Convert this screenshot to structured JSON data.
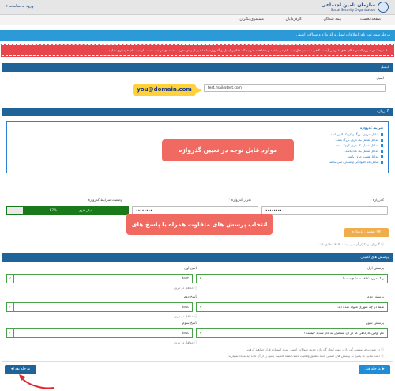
{
  "header": {
    "logo_fa": "سازمان تامین اجتماعی",
    "logo_en": "Social Security Organization",
    "portal_link": "ورود به سامانه"
  },
  "nav": {
    "items": [
      "صفحه نخست",
      "بیمه شدگان",
      "کارفرمایان",
      "مستمری بگیران"
    ]
  },
  "breadcrumb": "مرحله سوم ثبت نام: اطلاعات ایمیل و گذرواژه و سوالات امنیتی",
  "warning": "توجه: در صورتیکه در مکان های عمومی (مانند کافی نت) در حال ثبت نام می باشید و مشاهده نمودید که مقادیر ایمیل و گذرواژه یا مقادیر از پیش تعریف شده ای در ثبت است، از ثبت نام خودداری نمایید.",
  "email": {
    "section": "ایمیل",
    "label": "ایمیل",
    "value": "test.mail@test.com",
    "annotation": "you@domain.com"
  },
  "password": {
    "section": "گذرواژه",
    "rules_title": "شرایط گذرواژه",
    "rules": [
      "شامل حروف بزرگ و کوچک لاتین باشد.",
      "حداقل شامل یک حرف بزرگ باشد.",
      "حداقل شامل یک حرف کوچک باشد.",
      "حداقل شامل یک عدد باشد.",
      "حداقل هشت حرف باشد.",
      "شامل نام خانوادگی و شماره ملی نباشد."
    ],
    "annotation": "موارد قابل توجه در تعیین گذرواژه",
    "label": "گذرواژه",
    "confirm_label": "تکرار گذرواژه",
    "strength_label": "وضعیت شرایط گذرواژه",
    "value": "••••••••",
    "confirm_value": "••••••••",
    "strength_percent": "87%",
    "strength_text": "خیلی قوی",
    "show_button": "نمایش گذرواژه",
    "note": "گذرواژه و تکرار آن می بایست کاملا مطابق باشند."
  },
  "security": {
    "section": "پرسش های امنیتی",
    "annotation": "انتخاب پرسش های متفاوت همراه با پاسخ های متفاوت",
    "q1_label": "پرسش اول",
    "q1_value": "رنگ مورد علاقه شما چیست؟",
    "a1_label": "پاسخ اول",
    "a1_value": "test",
    "q2_label": "پرسش دوم",
    "q2_value": "شما در چه شهری متولد شده اید؟",
    "a2_label": "پاسخ دوم",
    "a2_value": "test",
    "q3_label": "پرسش سوم",
    "q3_value": "نام اولین کارگاهی که در آن مشغول به کار شدید چیست؟",
    "a3_label": "پاسخ سوم",
    "a3_value": "test",
    "min_hint": "حداقل دو حرف",
    "note1": "در صورت فراموشی گذرواژه، جهت ایجاد گذرواژه جدید، سوالات امنیتی مورد استفاده قرار خواهند گرفت.",
    "note2": "دقت نمایید که پاسخ به پرسش های امنیتی حتما مطابق واقعیت باشد، لطفا کاملیت پاسخ را از آن داده اید به یاد بسپارید."
  },
  "footer": {
    "next": "مرحله بعد",
    "prev": "مرحله قبل"
  },
  "colors": {
    "header_blue": "#1f6399",
    "crumb": "#2d9ad8",
    "warning": "#e6454c",
    "strength": "#1a7a1a",
    "next": "#1f6399",
    "prev": "#1f8dd6",
    "annotation_red": "#f06a62",
    "annotation_yellow": "#ffd23c"
  }
}
